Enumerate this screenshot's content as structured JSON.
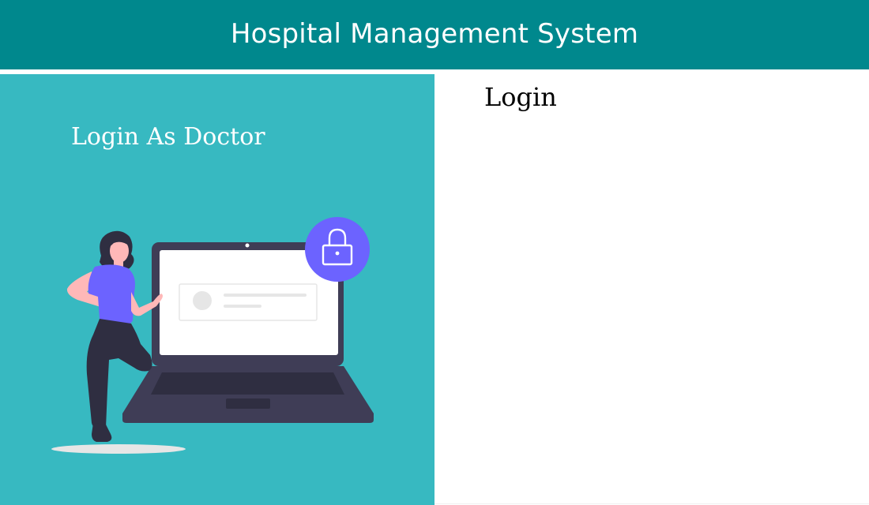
{
  "header": {
    "title": "Hospital Management System"
  },
  "left_panel": {
    "heading": "Login As Doctor",
    "illustration": "woman-with-laptop-lock-illustration"
  },
  "right_panel": {
    "heading": "Login"
  },
  "colors": {
    "header_bg": "#00888d",
    "left_panel_bg": "#37b9c1",
    "accent_purple": "#6c63ff",
    "laptop_dark": "#3f3d56"
  }
}
